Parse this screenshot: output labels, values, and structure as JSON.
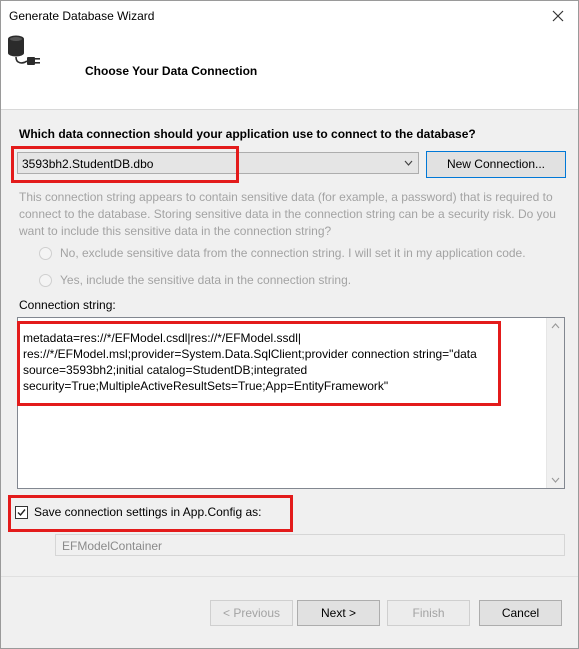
{
  "window": {
    "title": "Generate Database Wizard"
  },
  "header": {
    "title": "Choose Your Data Connection"
  },
  "connection": {
    "question": "Which data connection should your application use to connect to the database?",
    "selected": "3593bh2.StudentDB.dbo",
    "new_connection_label": "New Connection...",
    "sensitive_note": "This connection string appears to contain sensitive data (for example, a password) that is required to connect to the database. Storing sensitive data in the connection string can be a security risk. Do you want to include this sensitive data in the connection string?",
    "radio_no": "No, exclude sensitive data from the connection string. I will set it in my application code.",
    "radio_yes": "Yes, include the sensitive data in the connection string."
  },
  "connection_string": {
    "label": "Connection string:",
    "value": "metadata=res://*/EFModel.csdl|res://*/EFModel.ssdl|\nres://*/EFModel.msl;provider=System.Data.SqlClient;provider connection string=\"data\nsource=3593bh2;initial catalog=StudentDB;integrated\nsecurity=True;MultipleActiveResultSets=True;App=EntityFramework\""
  },
  "save": {
    "label": "Save connection settings in App.Config as:",
    "checked": true,
    "container_name": "EFModelContainer"
  },
  "buttons": {
    "previous": "< Previous",
    "next": "Next >",
    "finish": "Finish",
    "cancel": "Cancel"
  },
  "colors": {
    "highlight": "#e31b1b",
    "focus_border": "#0078d7"
  },
  "icons": [
    "database-plug-icon",
    "close-icon",
    "chevron-down-icon",
    "checkmark-icon",
    "scroll-up-icon",
    "scroll-down-icon"
  ]
}
